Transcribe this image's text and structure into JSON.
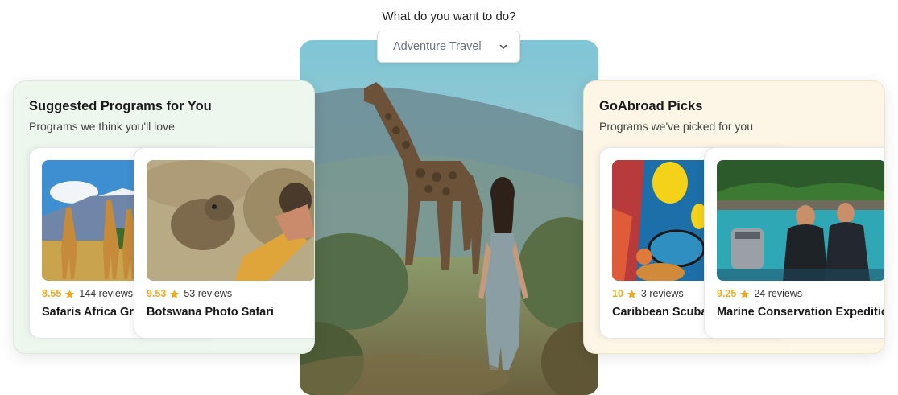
{
  "prompt": {
    "label": "What do you want to do?"
  },
  "activity_select": {
    "value": "Adventure Travel",
    "icon": "chevron-down-icon"
  },
  "suggested": {
    "title": "Suggested Programs for You",
    "subtitle": "Programs we think you'll love",
    "cards": [
      {
        "score": "8.55",
        "reviews": "144 reviews",
        "name": "Safaris Africa Gre",
        "image": "giraffes-under-mountain"
      },
      {
        "score": "9.53",
        "reviews": "53 reviews",
        "name": "Botswana Photo Safari",
        "image": "hyena-and-photographer"
      }
    ]
  },
  "picks": {
    "title": "GoAbroad Picks",
    "subtitle": "Programs we've picked for you",
    "cards": [
      {
        "score": "10",
        "reviews": "3 reviews",
        "name": "Caribbean Scuba",
        "image": "reef-fish-and-diver"
      },
      {
        "score": "9.25",
        "reviews": "24 reviews",
        "name": "Marine Conservation Expeditio",
        "image": "divers-on-boat"
      }
    ]
  },
  "colors": {
    "accent_score": "#f0a91e",
    "left_panel_bg": "#eef7ee",
    "right_panel_bg": "#fdf5e6"
  }
}
